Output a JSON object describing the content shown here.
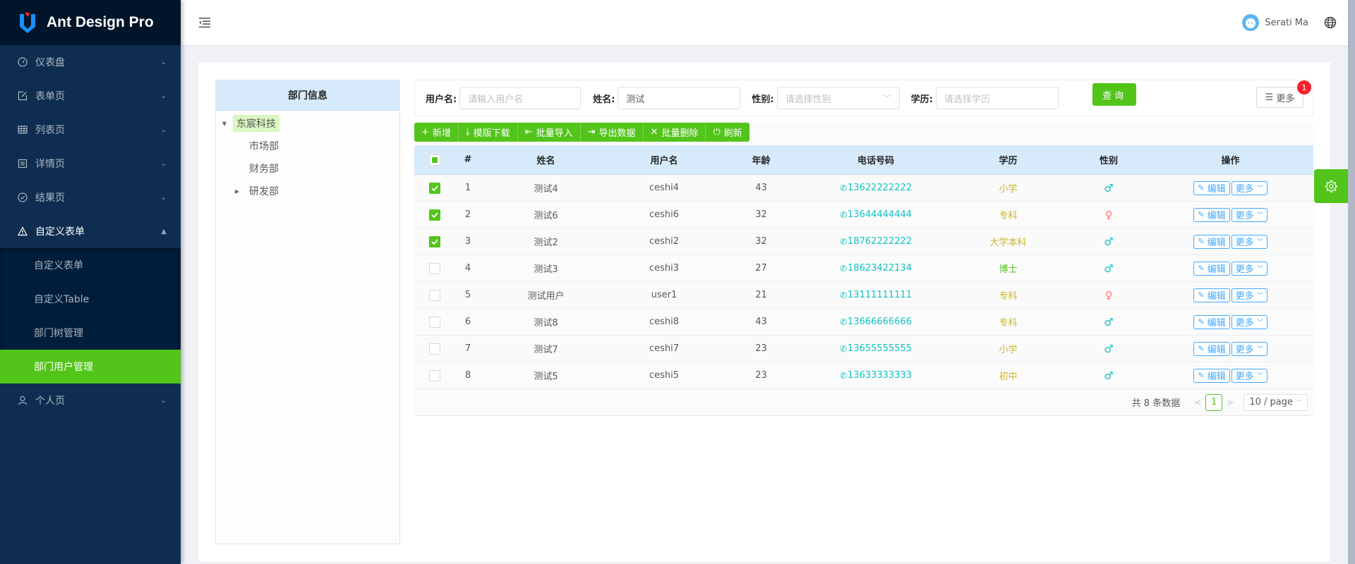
{
  "app": {
    "title": "Ant Design Pro"
  },
  "colors": {
    "primary": "#52c41a",
    "sider": "#0e2d50",
    "phone": "#13c2c2",
    "female": "#ff7875",
    "male": "#13c2c2",
    "edu": "#c8b62a",
    "edu_phd": "#52c41a"
  },
  "sidebar": {
    "items": [
      {
        "label": "仪表盘",
        "icon": "dashboard-icon"
      },
      {
        "label": "表单页",
        "icon": "form-icon"
      },
      {
        "label": "列表页",
        "icon": "table-icon"
      },
      {
        "label": "详情页",
        "icon": "profile-icon"
      },
      {
        "label": "结果页",
        "icon": "check-circle-icon"
      },
      {
        "label": "自定义表单",
        "icon": "warning-icon",
        "open": true
      },
      {
        "label": "个人页",
        "icon": "user-icon"
      }
    ],
    "submenu": [
      {
        "label": "自定义表单"
      },
      {
        "label": "自定义Table"
      },
      {
        "label": "部门树管理"
      },
      {
        "label": "部门用户管理",
        "active": true
      }
    ]
  },
  "header": {
    "username": "Serati Ma"
  },
  "tree": {
    "title": "部门信息",
    "nodes": [
      {
        "label": "东宸科技",
        "level": 0,
        "expanded": true,
        "selected": true
      },
      {
        "label": "市场部",
        "level": 1
      },
      {
        "label": "财务部",
        "level": 1
      },
      {
        "label": "研发部",
        "level": 1,
        "expandable": true
      }
    ]
  },
  "search": {
    "username_label": "用户名:",
    "username_placeholder": "请输入用户名",
    "name_label": "姓名:",
    "name_value": "测试",
    "gender_label": "性别:",
    "gender_placeholder": "请选择性别",
    "edu_label": "学历:",
    "edu_placeholder": "请选择学历",
    "query_label": "查询",
    "more_label": "更多",
    "more_badge": "1"
  },
  "toolbar": [
    {
      "label": "新增",
      "icon": "+"
    },
    {
      "label": "模版下载",
      "icon": "⤓"
    },
    {
      "label": "批量导入",
      "icon": "⇤"
    },
    {
      "label": "导出数据",
      "icon": "⇥"
    },
    {
      "label": "批量删除",
      "icon": "✕"
    },
    {
      "label": "刷新",
      "icon": "⏻"
    }
  ],
  "table": {
    "columns": [
      "#",
      "姓名",
      "用户名",
      "年龄",
      "电话号码",
      "学历",
      "性别",
      "操作"
    ],
    "rows": [
      {
        "idx": "1",
        "name": "测试4",
        "username": "ceshi4",
        "age": "43",
        "phone": "13622222222",
        "edu": "小学",
        "sex": "male",
        "checked": true
      },
      {
        "idx": "2",
        "name": "测试6",
        "username": "ceshi6",
        "age": "32",
        "phone": "13644444444",
        "edu": "专科",
        "sex": "female",
        "checked": true
      },
      {
        "idx": "3",
        "name": "测试2",
        "username": "ceshi2",
        "age": "32",
        "phone": "18762222222",
        "edu": "大学本科",
        "sex": "male",
        "checked": true
      },
      {
        "idx": "4",
        "name": "测试3",
        "username": "ceshi3",
        "age": "27",
        "phone": "18623422134",
        "edu": "博士",
        "sex": "male",
        "checked": false
      },
      {
        "idx": "5",
        "name": "测试用户",
        "username": "user1",
        "age": "21",
        "phone": "13111111111",
        "edu": "专科",
        "sex": "female",
        "checked": false
      },
      {
        "idx": "6",
        "name": "测试8",
        "username": "ceshi8",
        "age": "43",
        "phone": "13666666666",
        "edu": "专科",
        "sex": "male",
        "checked": false
      },
      {
        "idx": "7",
        "name": "测试7",
        "username": "ceshi7",
        "age": "23",
        "phone": "13655555555",
        "edu": "小学",
        "sex": "male",
        "checked": false
      },
      {
        "idx": "8",
        "name": "测试5",
        "username": "ceshi5",
        "age": "23",
        "phone": "13633333333",
        "edu": "初中",
        "sex": "male",
        "checked": false
      }
    ],
    "edit_label": "编辑",
    "more_label": "更多"
  },
  "pagination": {
    "total_text": "共 8 条数据",
    "current": "1",
    "page_size": "10 / page"
  }
}
